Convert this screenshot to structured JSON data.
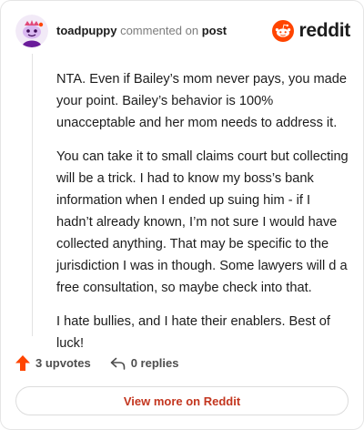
{
  "header": {
    "username": "toadpuppy",
    "commented_on": "commented on",
    "post_link": "post",
    "brand": "reddit"
  },
  "comment": {
    "paragraphs": [
      "NTA. Even if Bailey’s mom never pays, you made your point. Bailey’s behavior is 100% unacceptable and her mom needs to address it.",
      "You can take it to small claims court but collecting will be a trick. I had to know my boss’s bank information when I ended up suing him - if I hadn’t already known, I’m not sure I would have collected anything. That may be specific to the jurisdiction I was in though. Some lawyers will d a free consultation, so maybe check into that.",
      "I hate bullies, and I hate their enablers. Best of luck!"
    ]
  },
  "actions": {
    "upvotes_label": "3 upvotes",
    "replies_label": "0 replies"
  },
  "footer": {
    "view_more_label": "View more on Reddit"
  },
  "icons": {
    "avatar": "snoo-avatar",
    "brand_logo": "reddit-logo-icon",
    "upvote": "upvote-arrow-icon",
    "reply": "reply-arrow-icon"
  },
  "colors": {
    "brand": "#ff4500",
    "upvote": "#ff4500",
    "view_more_text": "#c3361f",
    "text": "#1c1c1c",
    "muted": "#7c7c7c"
  }
}
